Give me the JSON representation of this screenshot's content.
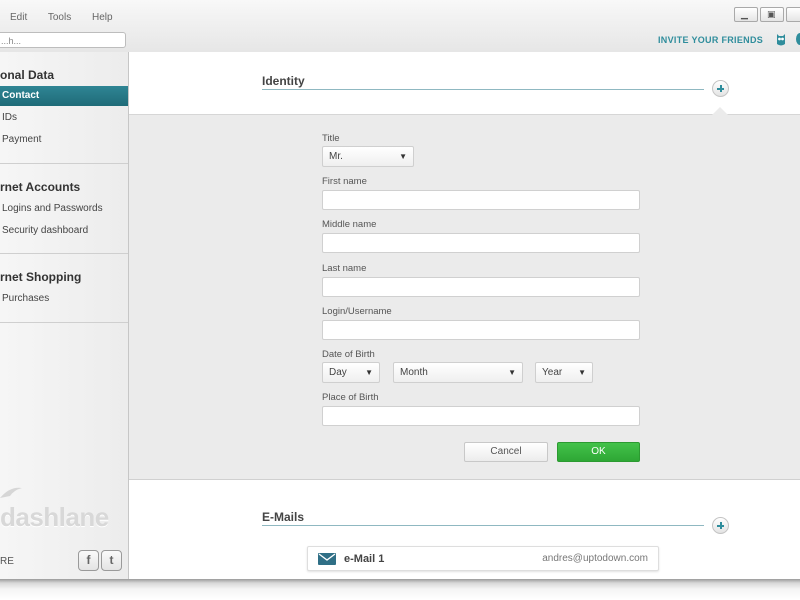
{
  "menu": [
    "Edit",
    "Tools",
    "Help"
  ],
  "search": {
    "placeholder": "...h..."
  },
  "header": {
    "invite_label": "INVITE YOUR FRIENDS"
  },
  "sidebar": {
    "sections": [
      {
        "title": "onal Data",
        "items": [
          "Contact",
          "IDs",
          "Payment"
        ]
      },
      {
        "title": "rnet Accounts",
        "items": [
          "Logins and Passwords",
          "Security dashboard"
        ]
      },
      {
        "title": "rnet Shopping",
        "items": [
          "Purchases"
        ]
      }
    ],
    "active_item": "Contact",
    "logo_text": "dashlane",
    "social_label": "RE",
    "social_icons": [
      "facebook-icon",
      "twitter-icon"
    ]
  },
  "identity": {
    "heading": "Identity",
    "fields": {
      "title_label": "Title",
      "title_value": "Mr.",
      "first_name_label": "First name",
      "middle_name_label": "Middle name",
      "last_name_label": "Last name",
      "login_label": "Login/Username",
      "dob_label": "Date of Birth",
      "dob_day": "Day",
      "dob_month": "Month",
      "dob_year": "Year",
      "pob_label": "Place of Birth"
    },
    "buttons": {
      "cancel": "Cancel",
      "ok": "OK"
    }
  },
  "emails": {
    "heading": "E-Mails",
    "entries": [
      {
        "label": "e-Mail 1",
        "value": "andres@uptodown.com"
      }
    ]
  },
  "colors": {
    "accent": "#2f8594",
    "ok_green": "#36b33d",
    "heading_line": "#8fb8c1"
  }
}
